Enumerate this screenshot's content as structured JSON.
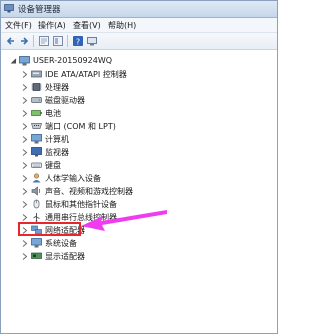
{
  "window": {
    "title": "设备管理器",
    "icon": "device-manager-icon"
  },
  "menu": {
    "items": [
      "文件(F)",
      "操作(A)",
      "查看(V)",
      "帮助(H)"
    ]
  },
  "toolbar": {
    "buttons": [
      "back-icon",
      "forward-icon",
      "properties-icon",
      "show-hide-tree-icon",
      "help-icon",
      "device-icon"
    ]
  },
  "tree": {
    "root": {
      "label": "USER-20150924WQ",
      "icon": "computer-icon",
      "expanded": true
    },
    "items": [
      {
        "label": "IDE ATA/ATAPI 控制器",
        "icon": "ide-controller-icon"
      },
      {
        "label": "处理器",
        "icon": "processor-icon"
      },
      {
        "label": "磁盘驱动器",
        "icon": "disk-drive-icon"
      },
      {
        "label": "电池",
        "icon": "battery-icon"
      },
      {
        "label": "端口 (COM 和 LPT)",
        "icon": "port-icon"
      },
      {
        "label": "计算机",
        "icon": "computer-icon"
      },
      {
        "label": "监视器",
        "icon": "monitor-icon"
      },
      {
        "label": "键盘",
        "icon": "keyboard-icon"
      },
      {
        "label": "人体学输入设备",
        "icon": "hid-icon"
      },
      {
        "label": "声音、视频和游戏控制器",
        "icon": "sound-icon"
      },
      {
        "label": "鼠标和其他指针设备",
        "icon": "mouse-icon"
      },
      {
        "label": "通用串行总线控制器",
        "icon": "usb-icon"
      },
      {
        "label": "网络适配器",
        "icon": "network-adapter-icon"
      },
      {
        "label": "系统设备",
        "icon": "system-device-icon"
      },
      {
        "label": "显示适配器",
        "icon": "display-adapter-icon"
      }
    ]
  },
  "annotation": {
    "highlight_color": "#e8262c",
    "arrow_color": "#f03cf0"
  }
}
